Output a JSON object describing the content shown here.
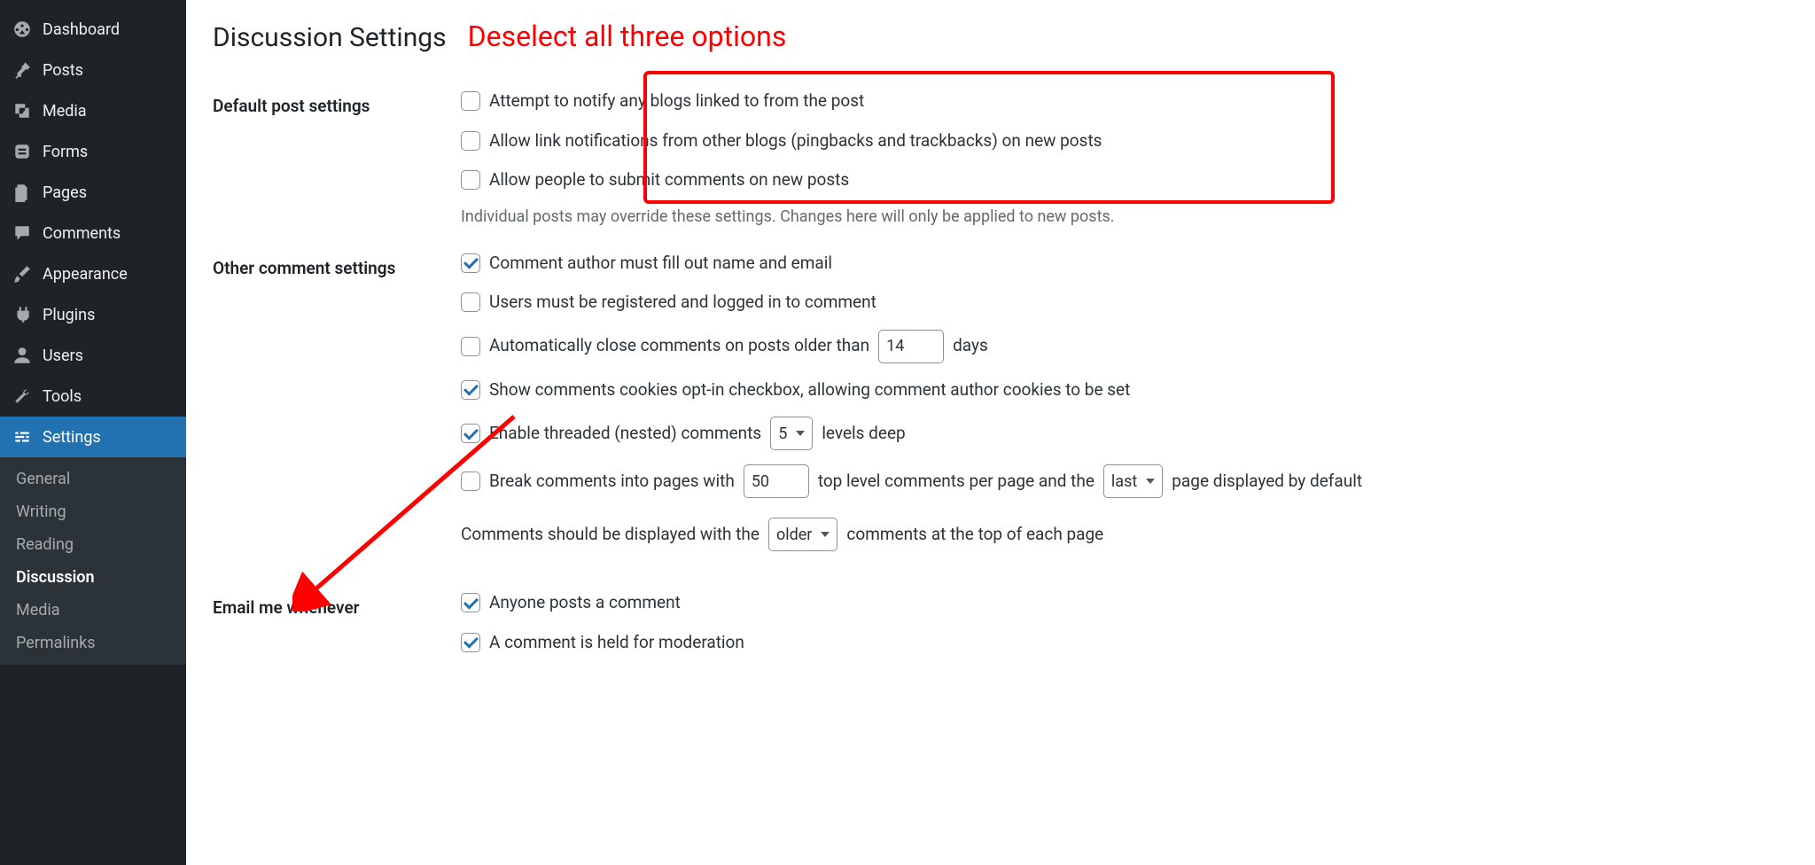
{
  "sidebar": {
    "items": [
      {
        "label": "Dashboard"
      },
      {
        "label": "Posts"
      },
      {
        "label": "Media"
      },
      {
        "label": "Forms"
      },
      {
        "label": "Pages"
      },
      {
        "label": "Comments"
      },
      {
        "label": "Appearance"
      },
      {
        "label": "Plugins"
      },
      {
        "label": "Users"
      },
      {
        "label": "Tools"
      },
      {
        "label": "Settings"
      }
    ],
    "submenu": [
      {
        "label": "General"
      },
      {
        "label": "Writing"
      },
      {
        "label": "Reading"
      },
      {
        "label": "Discussion"
      },
      {
        "label": "Media"
      },
      {
        "label": "Permalinks"
      }
    ]
  },
  "page": {
    "title": "Discussion Settings"
  },
  "annotation": {
    "text": "Deselect all three options"
  },
  "sections": {
    "default_post": {
      "heading": "Default post settings",
      "opt1": "Attempt to notify any blogs linked to from the post",
      "opt2": "Allow link notifications from other blogs (pingbacks and trackbacks) on new posts",
      "opt3": "Allow people to submit comments on new posts",
      "desc": "Individual posts may override these settings. Changes here will only be applied to new posts."
    },
    "other": {
      "heading": "Other comment settings",
      "opt1": "Comment author must fill out name and email",
      "opt2": "Users must be registered and logged in to comment",
      "opt3_pre": "Automatically close comments on posts older than",
      "opt3_days_value": "14",
      "opt3_days_label": "days",
      "opt4": "Show comments cookies opt-in checkbox, allowing comment author cookies to be set",
      "opt5_pre": "Enable threaded (nested) comments",
      "opt5_levels_value": "5",
      "opt5_levels_label": "levels deep",
      "opt6_pre": "Break comments into pages with",
      "opt6_toplevel_value": "50",
      "opt6_mid": "top level comments per page and the",
      "opt6_select_value": "last",
      "opt6_post": "page displayed by default",
      "opt7_pre": "Comments should be displayed with the",
      "opt7_select_value": "older",
      "opt7_post": "comments at the top of each page"
    },
    "email": {
      "heading": "Email me whenever",
      "opt1": "Anyone posts a comment",
      "opt2": "A comment is held for moderation"
    }
  }
}
